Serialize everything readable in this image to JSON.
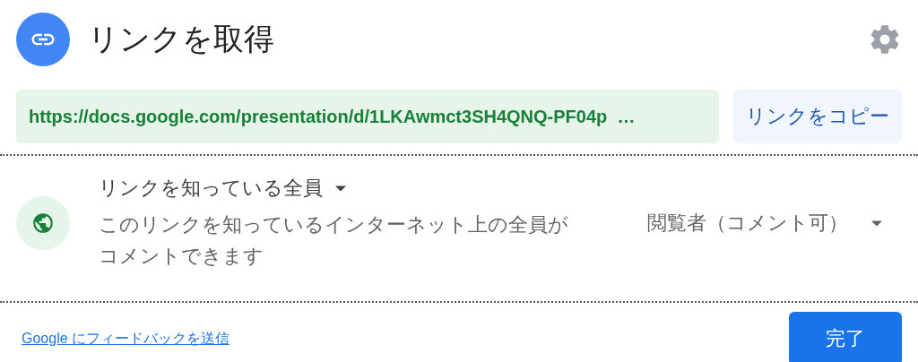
{
  "dialog": {
    "title": "リンクを取得"
  },
  "link": {
    "value": "https://docs.google.com/presentation/d/1LKAwmct3SH4QNQ-PF04p  …",
    "copy_button": "リンクをコピー"
  },
  "access": {
    "scope": "リンクを知っている全員",
    "description": "このリンクを知っているインターネット上の全員がコメントできます",
    "role": "閲覧者（コメント可）"
  },
  "footer": {
    "feedback_link": "Google にフィードバックを送信",
    "done_button": "完了"
  }
}
